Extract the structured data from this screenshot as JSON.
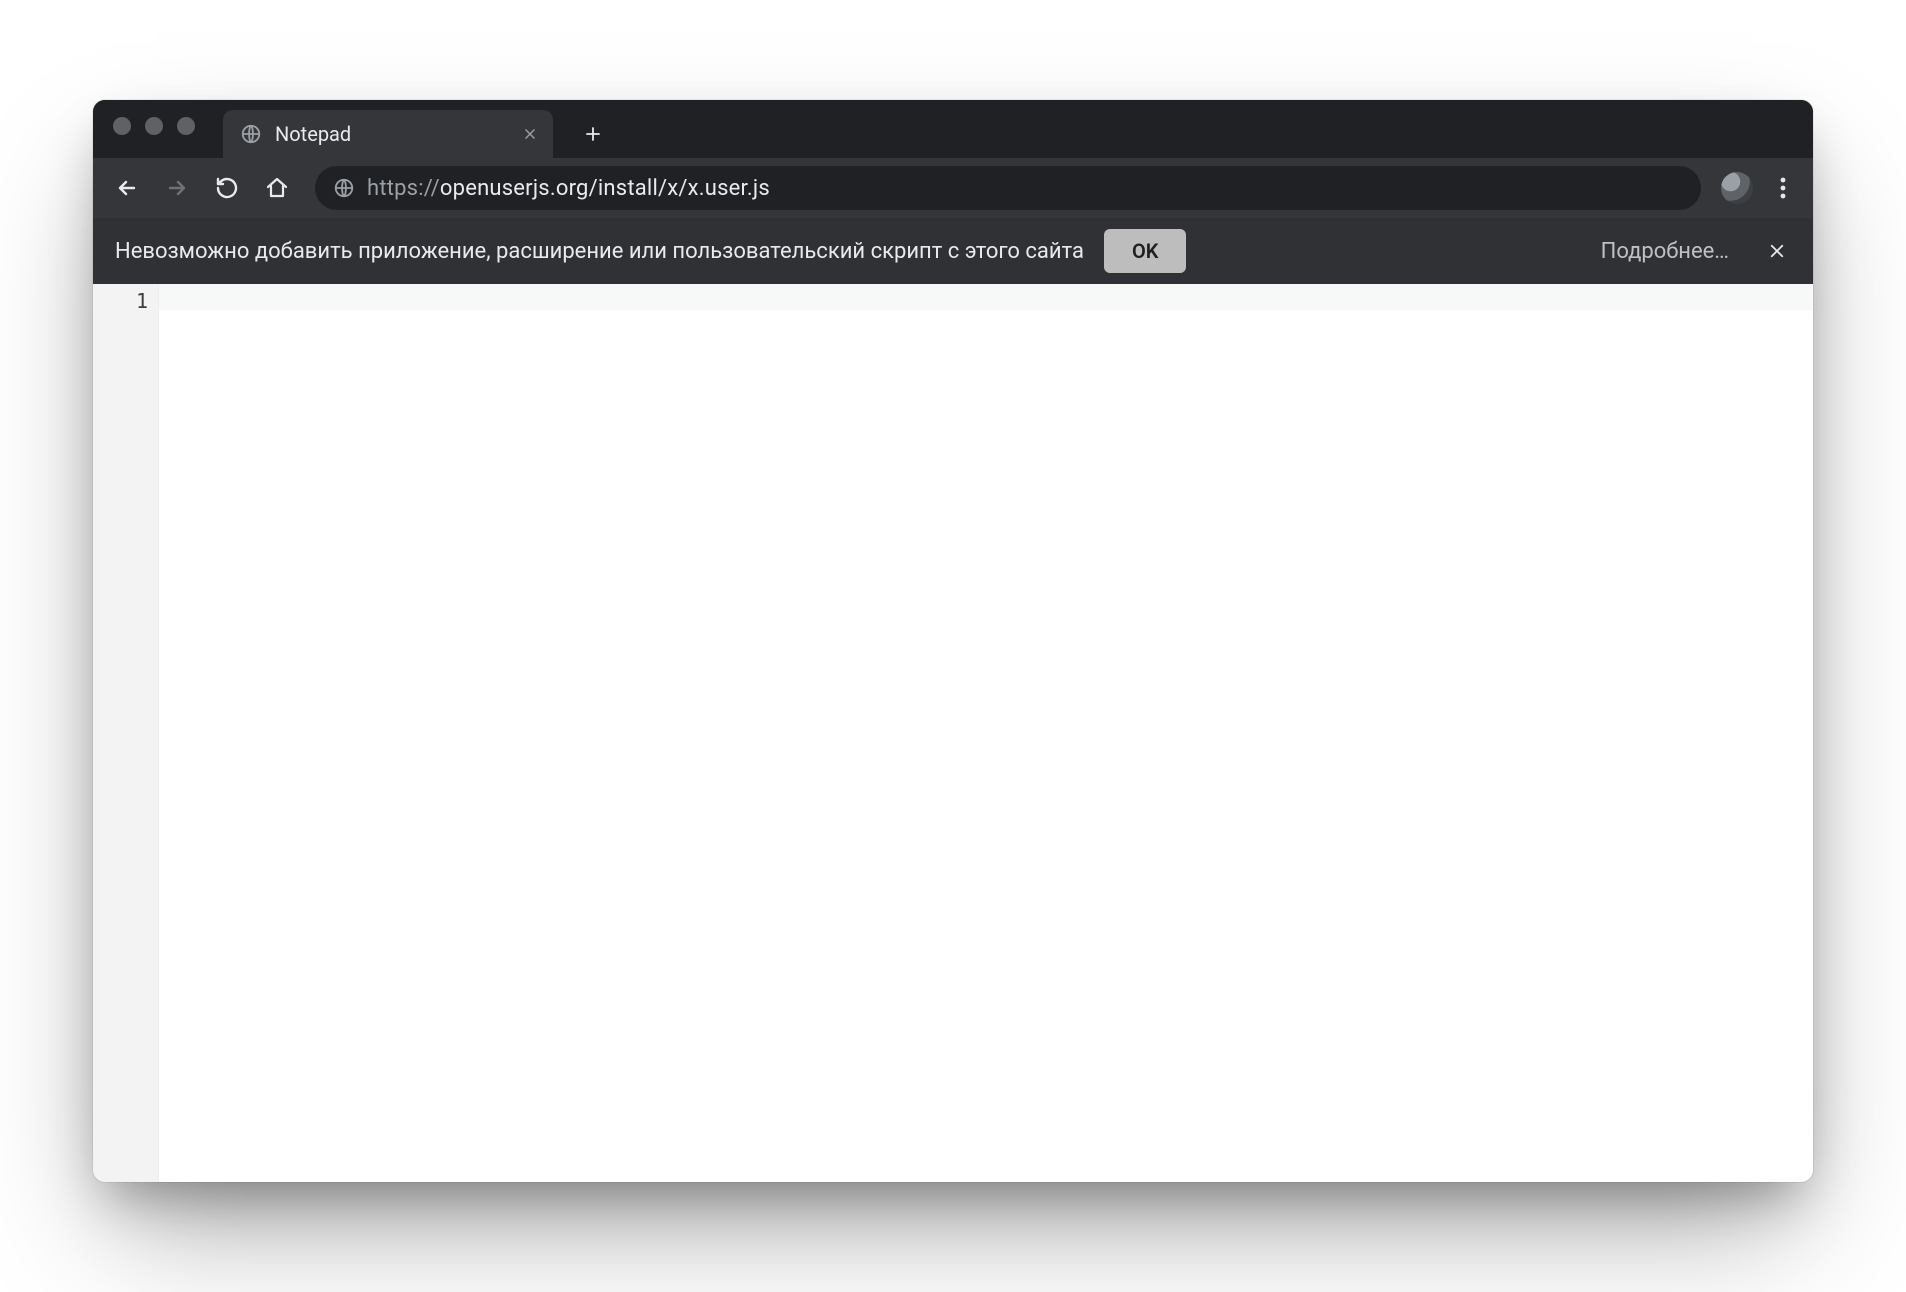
{
  "window": {
    "tab": {
      "title": "Notepad"
    },
    "url": {
      "prefix": "https://",
      "host": "openuserjs.org",
      "path": "/install/x/x.user.js"
    }
  },
  "infobar": {
    "message": "Невозможно добавить приложение, расширение или пользовательский скрипт с этого сайта",
    "ok_label": "OK",
    "more_label": "Подробнее…"
  },
  "editor": {
    "line_numbers": [
      "1"
    ],
    "lines": [
      ""
    ]
  },
  "colors": {
    "chrome_bg_dark": "#202124",
    "chrome_bg_mid": "#35363a",
    "chrome_bg_infobar": "#303134",
    "text_primary": "#e8eaed",
    "text_secondary": "#9aa0a6",
    "ok_button_bg": "#bdbdbd",
    "gutter_bg": "#f3f3f3"
  }
}
